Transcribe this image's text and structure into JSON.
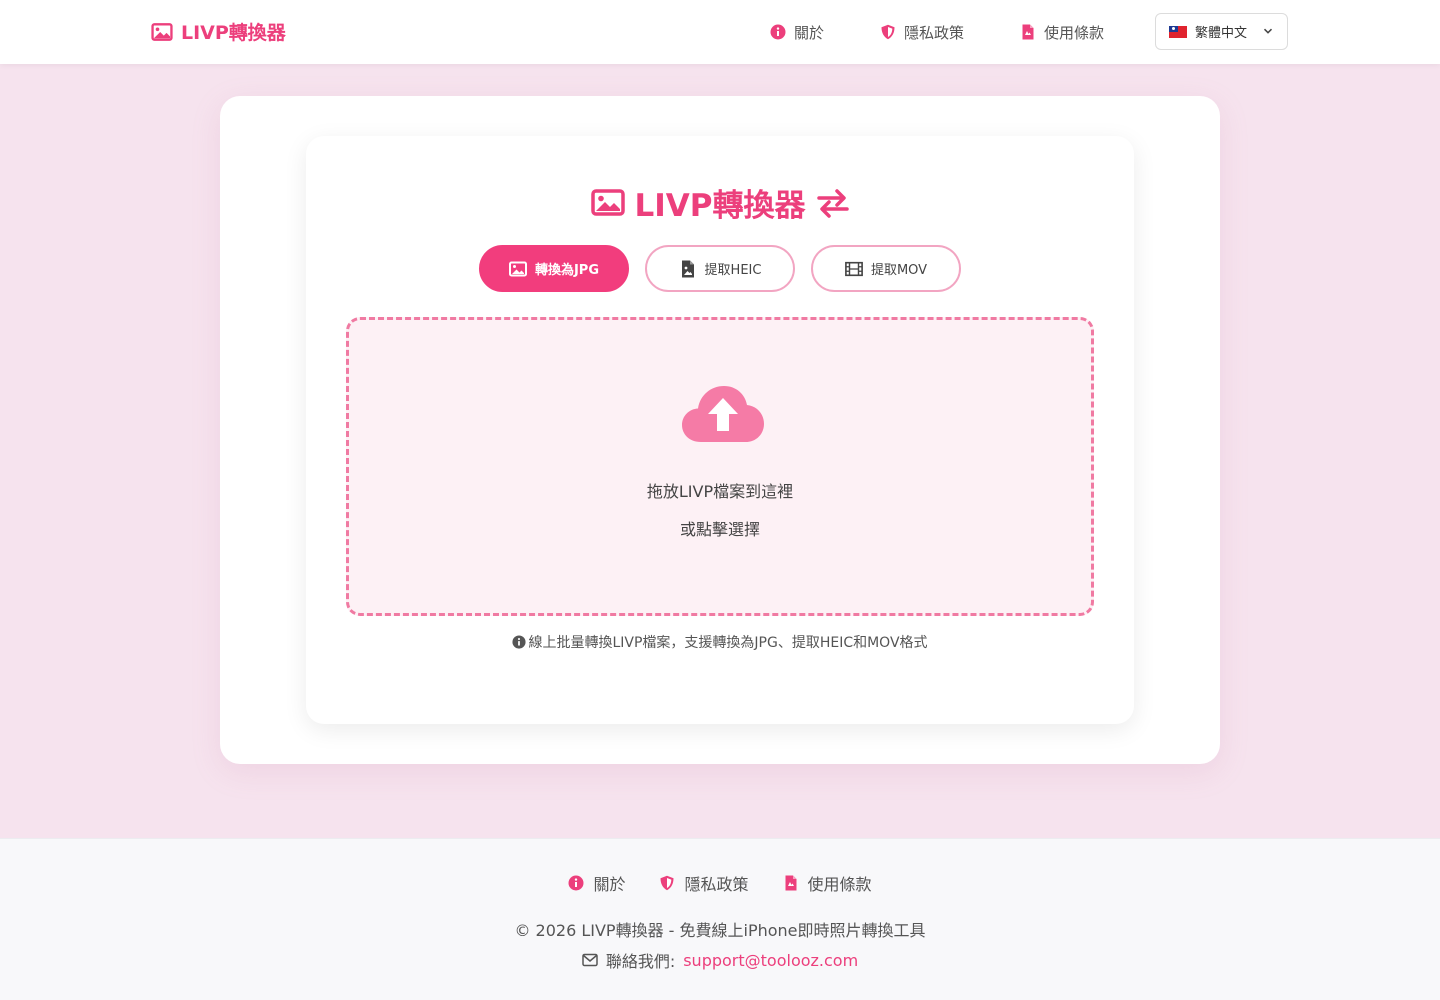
{
  "brand": {
    "name": "LIVP轉換器",
    "icon": "image-icon"
  },
  "nav": {
    "items": [
      {
        "label": "關於",
        "icon": "info-circle-icon"
      },
      {
        "label": "隱私政策",
        "icon": "shield-icon"
      },
      {
        "label": "使用條款",
        "icon": "document-icon"
      }
    ],
    "language": {
      "selected": "繁體中文",
      "flag": "taiwan-flag-icon"
    }
  },
  "converter": {
    "title": "LIVP轉換器",
    "tabs": [
      {
        "label": "轉換為JPG",
        "icon": "image-icon",
        "active": true
      },
      {
        "label": "提取HEIC",
        "icon": "file-image-icon",
        "active": false
      },
      {
        "label": "提取MOV",
        "icon": "film-icon",
        "active": false
      }
    ],
    "dropzone": {
      "icon": "cloud-upload-icon",
      "line1": "拖放LIVP檔案到這裡",
      "line2": "或點擊選擇"
    },
    "info": "線上批量轉換LIVP檔案，支援轉換為JPG、提取HEIC和MOV格式"
  },
  "footer": {
    "links": [
      {
        "label": "關於",
        "icon": "info-circle-icon"
      },
      {
        "label": "隱私政策",
        "icon": "shield-icon"
      },
      {
        "label": "使用條款",
        "icon": "document-icon"
      }
    ],
    "copyright": "© 2026 LIVP轉換器 - 免費線上iPhone即時照片轉換工具",
    "contact_label": "聯絡我們:",
    "contact_email": "support@toolooz.com"
  },
  "colors": {
    "accent": "#ec3f7c",
    "background": "#f6e3ee",
    "dropzone_bg": "#fdf1f5"
  }
}
